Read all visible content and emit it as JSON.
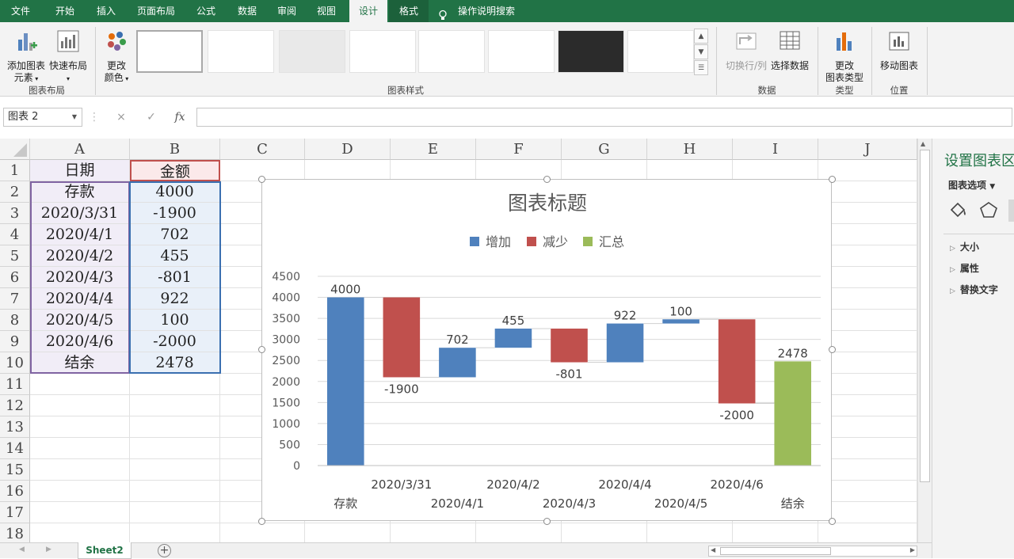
{
  "menu": {
    "tabs": [
      {
        "label": "文件"
      },
      {
        "label": "开始"
      },
      {
        "label": "插入"
      },
      {
        "label": "页面布局"
      },
      {
        "label": "公式"
      },
      {
        "label": "数据"
      },
      {
        "label": "审阅"
      },
      {
        "label": "视图"
      },
      {
        "label": "设计"
      },
      {
        "label": "格式"
      }
    ],
    "tell_me": "操作说明搜索"
  },
  "ribbon": {
    "add_element_line1": "添加图表",
    "add_element_line2": "元素",
    "quick_layout": "快速布局",
    "group_layout": "图表布局",
    "change_colors_line1": "更改",
    "change_colors_line2": "颜色",
    "group_styles": "图表样式",
    "switch_row_col": "切换行/列",
    "select_data": "选择数据",
    "group_data": "数据",
    "change_type_line1": "更改",
    "change_type_line2": "图表类型",
    "group_type": "类型",
    "move_chart": "移动图表",
    "group_location": "位置"
  },
  "formula_bar": {
    "name_box": "图表 2",
    "cancel_icon": "×",
    "enter_icon": "✓",
    "fx_label": "fx",
    "content": ""
  },
  "sheet": {
    "columns": [
      "A",
      "B",
      "C",
      "D",
      "E",
      "F",
      "G",
      "H",
      "I",
      "J"
    ],
    "rows": [
      "1",
      "2",
      "3",
      "4",
      "5",
      "6",
      "7",
      "8",
      "9",
      "10",
      "11",
      "12",
      "13",
      "14",
      "15",
      "16",
      "17",
      "18"
    ],
    "header_a": "日期",
    "header_b": "金额",
    "data": [
      {
        "a": "存款",
        "b": "4000"
      },
      {
        "a": "2020/3/31",
        "b": "-1900"
      },
      {
        "a": "2020/4/1",
        "b": "702"
      },
      {
        "a": "2020/4/2",
        "b": "455"
      },
      {
        "a": "2020/4/3",
        "b": "-801"
      },
      {
        "a": "2020/4/4",
        "b": "922"
      },
      {
        "a": "2020/4/5",
        "b": "100"
      },
      {
        "a": "2020/4/6",
        "b": "-2000"
      },
      {
        "a": "结余",
        "b": "2478"
      }
    ],
    "tab_name": "Sheet2"
  },
  "chart_data": {
    "type": "bar",
    "subtype": "waterfall",
    "title": "图表标题",
    "legend": [
      "增加",
      "减少",
      "汇总"
    ],
    "legend_position": "top",
    "colors": {
      "increase": "#4f81bd",
      "decrease": "#c0504d",
      "total": "#9bbb59"
    },
    "categories": [
      "存款",
      "2020/3/31",
      "2020/4/1",
      "2020/4/2",
      "2020/4/3",
      "2020/4/4",
      "2020/4/5",
      "2020/4/6",
      "结余"
    ],
    "values": [
      4000,
      -1900,
      702,
      455,
      -801,
      922,
      100,
      -2000,
      2478
    ],
    "kinds": [
      "total",
      "decrease",
      "increase",
      "increase",
      "decrease",
      "increase",
      "increase",
      "decrease",
      "total"
    ],
    "data_labels": [
      "4000",
      "-1900",
      "702",
      "455",
      "-801",
      "922",
      "100",
      "-2000",
      "2478"
    ],
    "ylim": [
      0,
      4500
    ],
    "yticks": [
      "0",
      "500",
      "1000",
      "1500",
      "2000",
      "2500",
      "3000",
      "3500",
      "4000",
      "4500"
    ],
    "grid": true
  },
  "side_pane": {
    "title": "设置图表区",
    "options_label": "图表选项",
    "items": [
      "大小",
      "属性",
      "替换文字"
    ]
  },
  "accent_color": "#217346"
}
